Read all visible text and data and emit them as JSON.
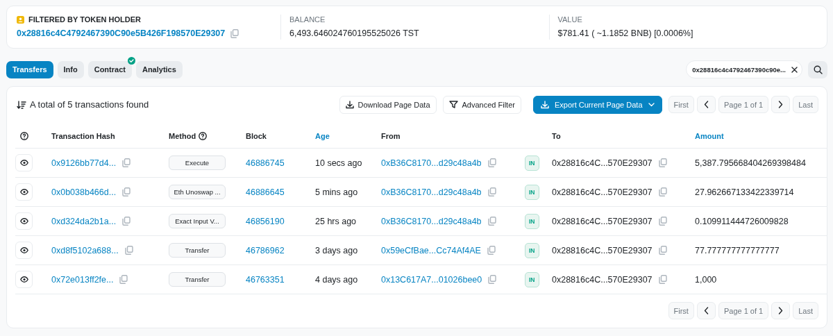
{
  "summary": [
    {
      "label": "FILTERED BY TOKEN HOLDER",
      "value": "0x28816c4C4792467390C90e5B426F198570E29307",
      "kind": "address"
    },
    {
      "label": "BALANCE",
      "value": "6,493.646024760195525026 TST",
      "kind": "text"
    },
    {
      "label": "VALUE",
      "value": "$781.41 ( ~1.1852 BNB) [0.0006%]",
      "kind": "text"
    }
  ],
  "tabs": [
    {
      "label": "Transfers",
      "selected": true,
      "verified": false
    },
    {
      "label": "Info",
      "selected": false,
      "verified": false
    },
    {
      "label": "Contract",
      "selected": false,
      "verified": true
    },
    {
      "label": "Analytics",
      "selected": false,
      "verified": false
    }
  ],
  "filter_chip": {
    "value": "0x28816c4c4792467390c90e..."
  },
  "total_text": "A total of 5 transactions found",
  "toolbar_buttons": [
    {
      "label": "Download Page Data",
      "kind": "download"
    },
    {
      "label": "Advanced Filter",
      "kind": "filter"
    },
    {
      "label": "Export Current Page Data",
      "kind": "export"
    }
  ],
  "pagination_top": {
    "first": "First",
    "page": "Page 1 of 1",
    "last": "Last"
  },
  "table": {
    "columns": [
      {
        "kind": "help"
      },
      {
        "label": "Transaction Hash",
        "kind": "plain"
      },
      {
        "label": "Method",
        "kind": "help-label"
      },
      {
        "label": "Block",
        "kind": "plain"
      },
      {
        "label": "Age",
        "kind": "link"
      },
      {
        "label": "From",
        "kind": "plain"
      },
      {
        "kind": "blank"
      },
      {
        "label": "To",
        "kind": "plain"
      },
      {
        "label": "Amount",
        "kind": "link"
      }
    ],
    "rows": [
      {
        "hash": "0x9126bb77d4...",
        "method": "Execute",
        "block": "46886745",
        "age": "10 secs ago",
        "from": "0xB36C8170...d29c48a4b",
        "direction": "IN",
        "to": "0x28816c4C...570E29307",
        "amount": "5,387.795668404269398484"
      },
      {
        "hash": "0x0b038b466d...",
        "method": "Eth Unoswap ...",
        "block": "46886645",
        "age": "5 mins ago",
        "from": "0xB36C8170...d29c48a4b",
        "direction": "IN",
        "to": "0x28816c4C...570E29307",
        "amount": "27.962667133422339714"
      },
      {
        "hash": "0xd324da2b1a...",
        "method": "Exact Input V...",
        "block": "46856190",
        "age": "25 hrs ago",
        "from": "0xB36C8170...d29c48a4b",
        "direction": "IN",
        "to": "0x28816c4C...570E29307",
        "amount": "0.109911444726009828"
      },
      {
        "hash": "0xd8f5102a688...",
        "method": "Transfer",
        "block": "46786962",
        "age": "3 days ago",
        "from": "0x59eCfBae...Cc74Af4AE",
        "direction": "IN",
        "to": "0x28816c4C...570E29307",
        "amount": "77.777777777777777"
      },
      {
        "hash": "0x72e013ff2fe...",
        "method": "Transfer",
        "block": "46763351",
        "age": "4 days ago",
        "from": "0x13C617A7...01026bee0",
        "direction": "IN",
        "to": "0x28816c4C...570E29307",
        "amount": "1,000"
      }
    ]
  },
  "pagination_bottom": {
    "first": "First",
    "page": "Page 1 of 1",
    "last": "Last"
  }
}
